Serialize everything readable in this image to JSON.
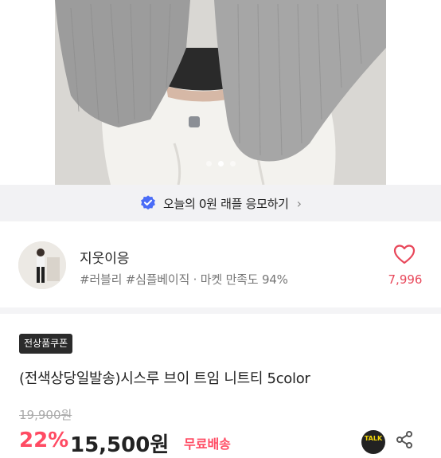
{
  "gallery": {
    "slide_count": 3,
    "active_index": 1
  },
  "banner": {
    "text": "오늘의 0원 래플 응모하기",
    "chevron": "›",
    "icon": "verified-check-icon",
    "accent_color": "#4a6cf7"
  },
  "seller": {
    "name": "지웃이응",
    "tags": "#러블리 #심플베이직 · 마켓 만족도 94%",
    "likes": "7,996",
    "like_color": "#e8475a"
  },
  "product": {
    "coupon_badge": "전상품쿠폰",
    "title": "(전색상당일발송)시스루 브이 트임 니트티 5color",
    "original_price": "19,900원",
    "discount": "22%",
    "sale_price": "15,500원",
    "shipping": "무료배송",
    "talk_label": "TALK",
    "accent_color": "#ff4b63"
  }
}
